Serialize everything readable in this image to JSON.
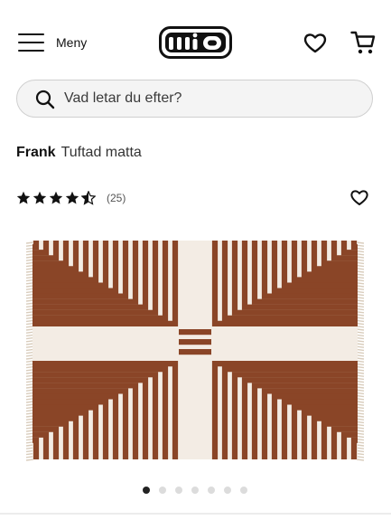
{
  "header": {
    "menu_label": "Meny",
    "logo_text": "mio",
    "icons": {
      "menu": "hamburger-icon",
      "favorites": "heart-icon",
      "cart": "cart-icon"
    }
  },
  "search": {
    "placeholder": "Vad letar du efter?",
    "value": "",
    "icon": "search-icon"
  },
  "product": {
    "brand": "Frank",
    "name": "Tuftad matta",
    "rating": 4.5,
    "rating_max": 5,
    "review_count": "(25)",
    "image": {
      "description_icon": "striped-rug-image",
      "stripe_color": "#8a4527",
      "base_color": "#f3ece4",
      "fringe_color": "#d9cdbd"
    }
  },
  "carousel": {
    "total": 7,
    "active_index": 0
  },
  "colors": {
    "text": "#1a1a1a",
    "search_bg": "#f4f4f4",
    "dot_inactive": "#dcdcdc",
    "dot_active": "#222222"
  }
}
